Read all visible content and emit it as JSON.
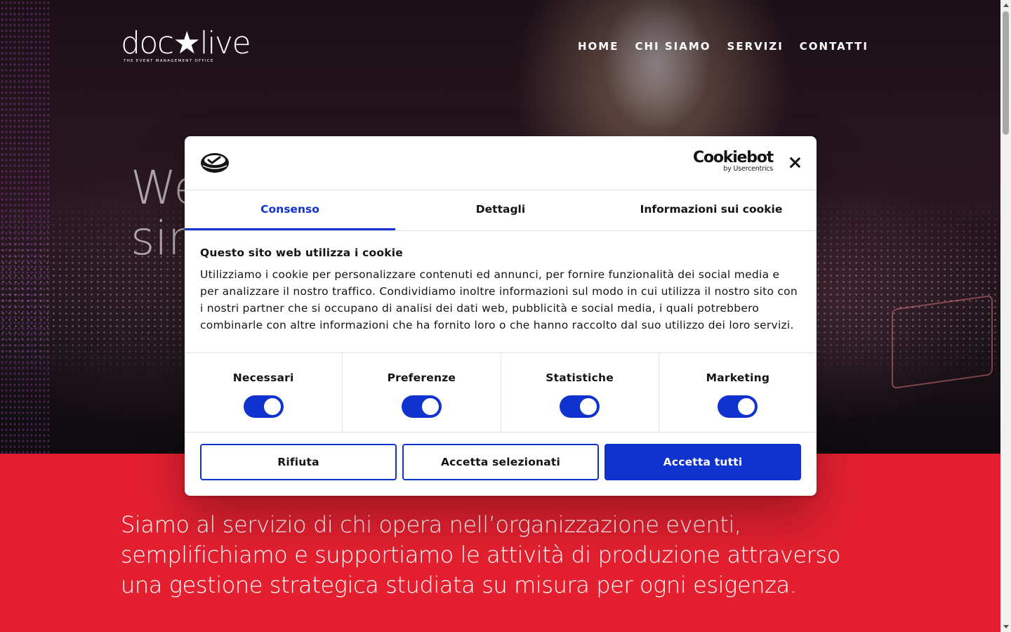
{
  "site": {
    "logo_text": "doc★live",
    "logo_tagline": "THE EVENT MANAGEMENT OFFICE",
    "nav": [
      "HOME",
      "CHI SIAMO",
      "SERVIZI",
      "CONTATTI"
    ],
    "hero_title_line1": "We",
    "hero_title_line2": "sin",
    "intro": "Siamo al servizio di chi opera nell’organizzazione eventi, semplifichiamo e supportiamo le attività di produzione attraverso una gestione strategica studiata su misura per ogni esigenza."
  },
  "cookie_dialog": {
    "brand_name": "Cookiebot",
    "brand_by": "by Usercentrics",
    "tabs": [
      "Consenso",
      "Dettagli",
      "Informazioni sui cookie"
    ],
    "active_tab": "Consenso",
    "heading": "Questo sito web utilizza i cookie",
    "body": "Utilizziamo i cookie per personalizzare contenuti ed annunci, per fornire funzionalità dei social media e per analizzare il nostro traffico. Condividiamo inoltre informazioni sul modo in cui utilizza il nostro sito con i nostri partner che si occupano di analisi dei dati web, pubblicità e social media, i quali potrebbero combinarle con altre informazioni che ha fornito loro o che hanno raccolto dal suo utilizzo dei loro servizi.",
    "toggles": [
      {
        "label": "Necessari",
        "on": true
      },
      {
        "label": "Preferenze",
        "on": true
      },
      {
        "label": "Statistiche",
        "on": true
      },
      {
        "label": "Marketing",
        "on": true
      }
    ],
    "buttons": {
      "reject": "Rifiuta",
      "accept_selected": "Accetta selezionati",
      "accept_all": "Accetta tutti"
    }
  },
  "colors": {
    "accent_blue": "#1032cf",
    "brand_red": "#e42030"
  }
}
